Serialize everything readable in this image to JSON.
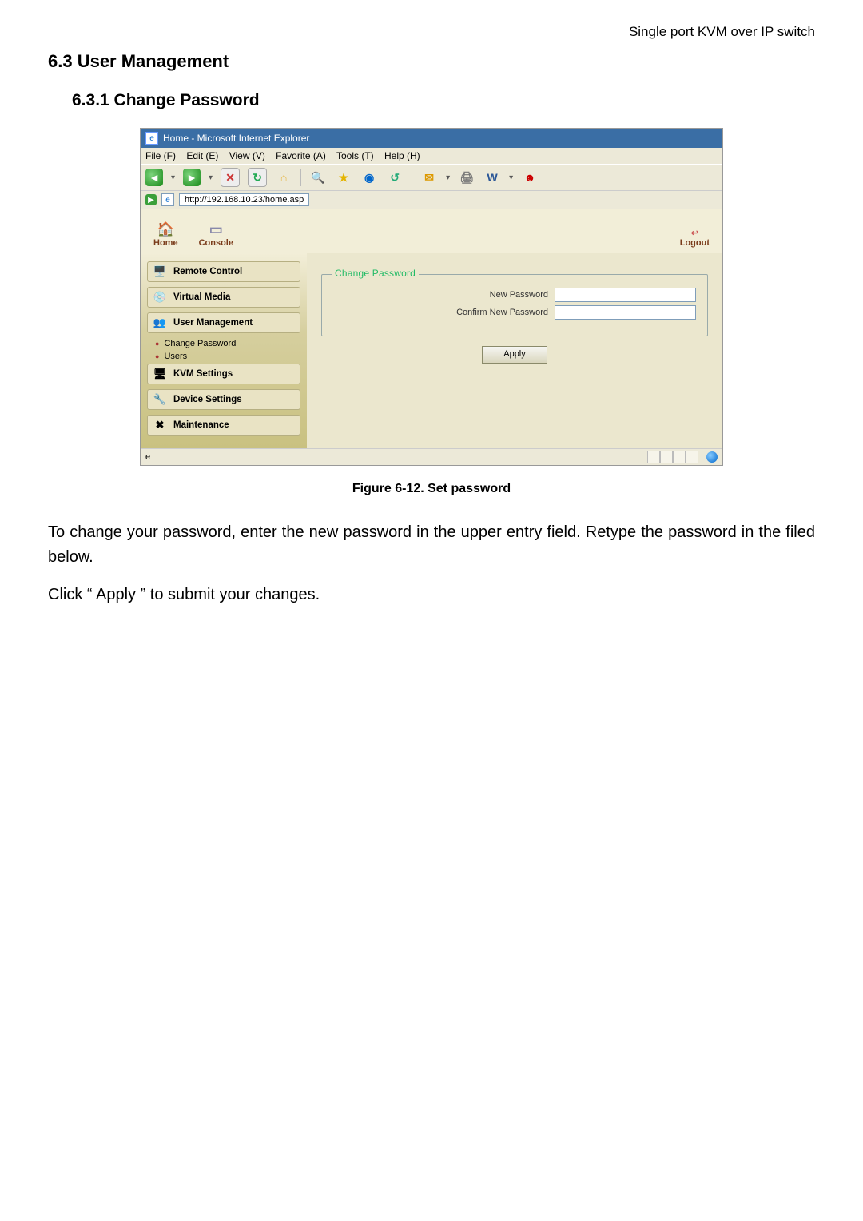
{
  "doc": {
    "header_right": "Single port KVM over IP switch",
    "h1": "6.3 User Management",
    "h2": "6.3.1    Change Password",
    "caption": "Figure 6-12. Set password",
    "para1": "To change your password, enter the new password in the upper entry field. Retype the password in the filed below.",
    "para2": "Click “ Apply ” to submit your changes."
  },
  "ie": {
    "title": "Home - Microsoft Internet Explorer",
    "menus": [
      "File (F)",
      "Edit (E)",
      "View (V)",
      "Favorite (A)",
      "Tools (T)",
      "Help (H)"
    ],
    "address_url": "http://192.168.10.23/home.asp"
  },
  "tabs": {
    "home": "Home",
    "console": "Console",
    "logout": "Logout"
  },
  "nav": {
    "items": [
      {
        "label": "Remote Control",
        "icon": "🖥️"
      },
      {
        "label": "Virtual Media",
        "icon": "💿"
      },
      {
        "label": "User Management",
        "icon": "👥"
      },
      {
        "label": "KVM Settings",
        "icon": "🖥"
      },
      {
        "label": "Device Settings",
        "icon": "🔧"
      },
      {
        "label": "Maintenance",
        "icon": "✖"
      }
    ],
    "subs": [
      "Change Password",
      "Users"
    ]
  },
  "form": {
    "legend": "Change Password",
    "new_label": "New Password",
    "confirm_label": "Confirm New Password",
    "apply": "Apply"
  }
}
